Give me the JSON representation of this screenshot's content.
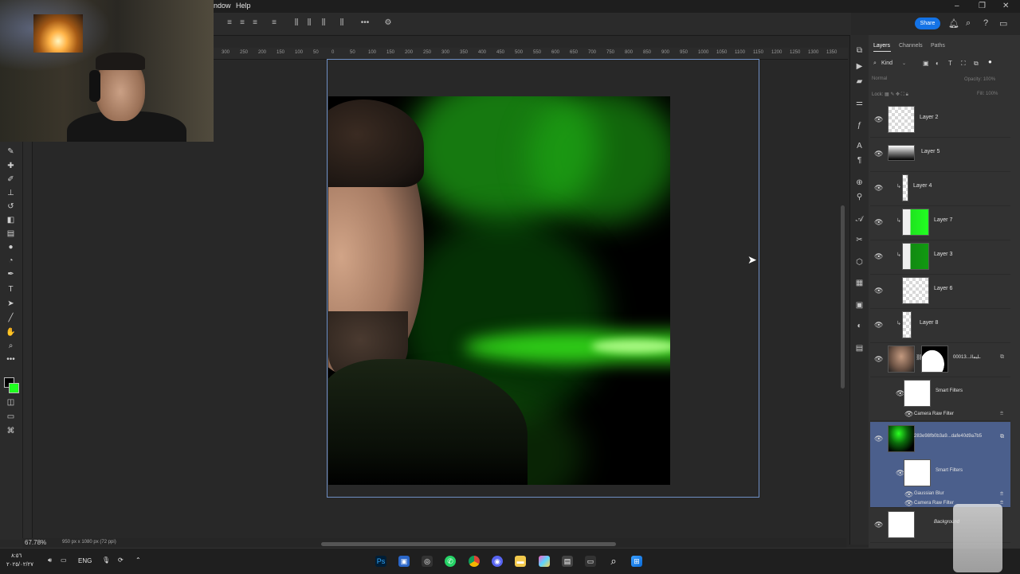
{
  "menu": {
    "window_label": "ndow",
    "help_label": "Help"
  },
  "topbar": {
    "share_label": "Share"
  },
  "ruler": {
    "ticks": [
      "300",
      "250",
      "200",
      "150",
      "100",
      "50",
      "0",
      "50",
      "100",
      "150",
      "200",
      "250",
      "300",
      "350",
      "400",
      "450",
      "500",
      "550",
      "600",
      "650",
      "700",
      "750",
      "800",
      "850",
      "900",
      "950",
      "1000",
      "1050",
      "1100",
      "1150",
      "1200",
      "1250",
      "1300",
      "1350"
    ]
  },
  "status": {
    "zoom": "67.78%",
    "dimensions": "950 px x 1080 px (72 ppi)"
  },
  "panel": {
    "tabs": [
      "Layers",
      "Channels",
      "Paths"
    ],
    "filter_kind": "Kind",
    "blend_mode": "Normal",
    "opacity_label": "Opacity:",
    "opacity_value": "100%",
    "lock_label": "Lock:",
    "fill_label": "Fill:",
    "fill_value": "100%"
  },
  "layers": [
    {
      "name": "Layer 2"
    },
    {
      "name": "Layer 5"
    },
    {
      "name": "Layer 4"
    },
    {
      "name": "Layer 7"
    },
    {
      "name": "Layer 3"
    },
    {
      "name": "Layer 6"
    },
    {
      "name": "Layer 8"
    },
    {
      "name": "00013...ـﻠﻴﻤﺎﻟ"
    },
    {
      "name": "Smart Filters",
      "sub": "Camera Raw Filter"
    },
    {
      "name": "283e98fb0b3a9...dafe40d9a7b5"
    },
    {
      "name": "Smart Filters",
      "sub1": "Gaussian Blur",
      "sub2": "Camera Raw Filter"
    },
    {
      "name": "Background"
    }
  ],
  "taskbar": {
    "time": "٨:٥٦",
    "date": "٢٠٢٥/٠٢/٢٧",
    "language": "ENG"
  },
  "colors": {
    "accent": "#1473e6",
    "selection": "#4b5f8c",
    "artboard_border": "#6f8fc4",
    "glow_green": "#26ff1a"
  }
}
